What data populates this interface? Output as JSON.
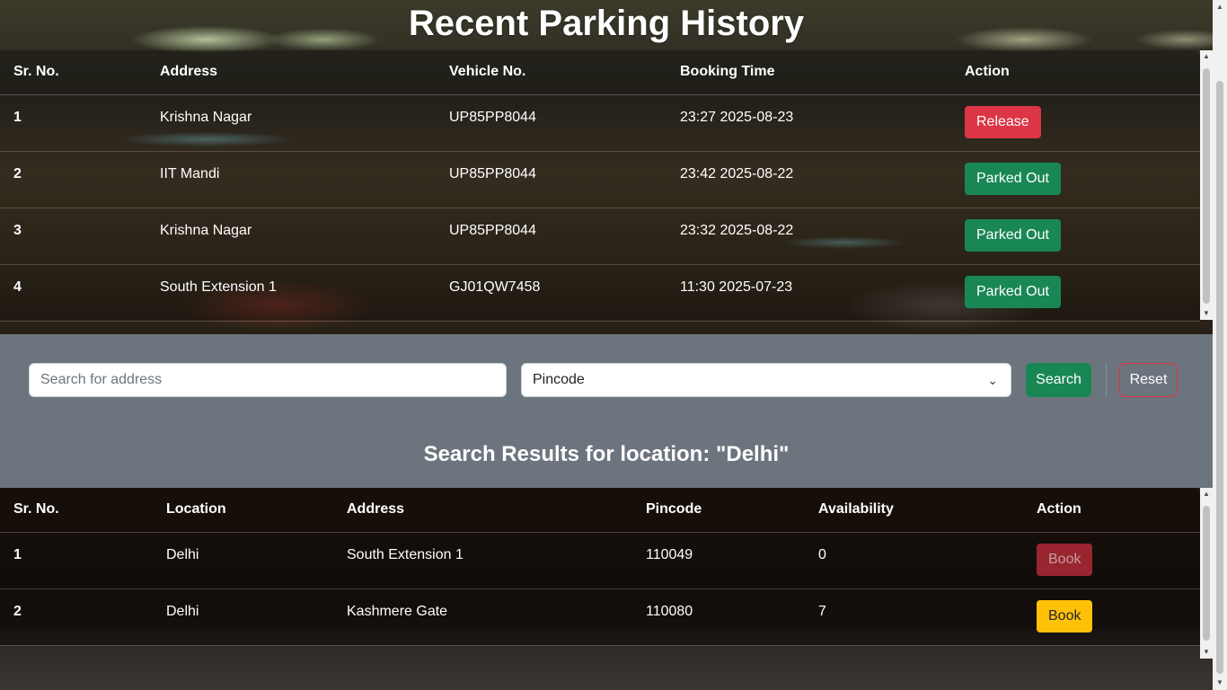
{
  "page_title": "Recent Parking History",
  "history": {
    "headers": [
      "Sr. No.",
      "Address",
      "Vehicle No.",
      "Booking Time",
      "Action"
    ],
    "rows": [
      {
        "sr": "1",
        "address": "Krishna Nagar",
        "vehicle": "UP85PP8044",
        "time": "23:27 2025-08-23",
        "action": "Release"
      },
      {
        "sr": "2",
        "address": "IIT Mandi",
        "vehicle": "UP85PP8044",
        "time": "23:42 2025-08-22",
        "action": "Parked Out"
      },
      {
        "sr": "3",
        "address": "Krishna Nagar",
        "vehicle": "UP85PP8044",
        "time": "23:32 2025-08-22",
        "action": "Parked Out"
      },
      {
        "sr": "4",
        "address": "South Extension 1",
        "vehicle": "GJ01QW7458",
        "time": "11:30 2025-07-23",
        "action": "Parked Out"
      }
    ]
  },
  "search": {
    "placeholder": "Search for address",
    "pincode_value": "Pincode",
    "search_label": "Search",
    "reset_label": "Reset",
    "results_title": "Search Results for location: \"Delhi\""
  },
  "results": {
    "headers": [
      "Sr. No.",
      "Location",
      "Address",
      "Pincode",
      "Availability",
      "Action"
    ],
    "rows": [
      {
        "sr": "1",
        "location": "Delhi",
        "address": "South Extension 1",
        "pincode": "110049",
        "availability": "0",
        "action": "Book"
      },
      {
        "sr": "2",
        "location": "Delhi",
        "address": "Kashmere Gate",
        "pincode": "110080",
        "availability": "7",
        "action": "Book"
      }
    ]
  },
  "colors": {
    "release": "#dc3545",
    "parked_out": "#198754",
    "book_available": "#ffc107",
    "book_unavailable": "#b02a37",
    "search_band": "#6c757d"
  },
  "icons": {
    "select_chevron": "chevron-down-icon",
    "scroll_up": "scroll-up-arrow-icon",
    "scroll_down": "scroll-down-arrow-icon"
  }
}
